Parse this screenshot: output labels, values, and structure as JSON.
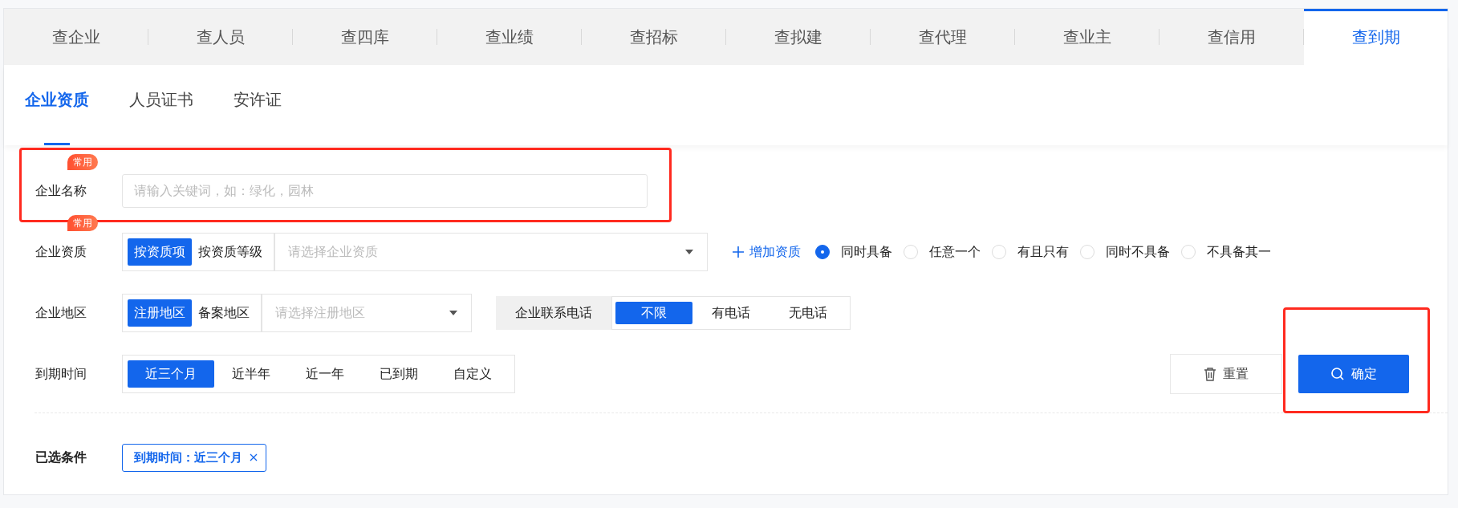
{
  "top_tabs": [
    {
      "label": "查企业",
      "selected": false
    },
    {
      "label": "查人员",
      "selected": false
    },
    {
      "label": "查四库",
      "selected": false
    },
    {
      "label": "查业绩",
      "selected": false
    },
    {
      "label": "查招标",
      "selected": false
    },
    {
      "label": "查拟建",
      "selected": false
    },
    {
      "label": "查代理",
      "selected": false
    },
    {
      "label": "查业主",
      "selected": false
    },
    {
      "label": "查信用",
      "selected": false
    },
    {
      "label": "查到期",
      "selected": true
    }
  ],
  "sub_tabs": [
    {
      "label": "企业资质",
      "selected": true
    },
    {
      "label": "人员证书",
      "selected": false
    },
    {
      "label": "安许证",
      "selected": false
    }
  ],
  "filters": [
    {
      "kind": "input",
      "label": "企业名称",
      "badge": "常用",
      "placeholder": "请输入关键词，如：绿化，园林",
      "highlighted": true
    },
    {
      "kind": "qualification",
      "label": "企业资质",
      "badge": "常用",
      "modes": [
        {
          "label": "按资质项",
          "selected": true
        },
        {
          "label": "按资质等级",
          "selected": false
        }
      ],
      "select_placeholder": "请选择企业资质",
      "add_link": "增加资质",
      "radios": [
        {
          "label": "同时具备",
          "selected": true
        },
        {
          "label": "任意一个",
          "selected": false
        },
        {
          "label": "有且只有",
          "selected": false
        },
        {
          "label": "同时不具备",
          "selected": false
        },
        {
          "label": "不具备其一",
          "selected": false
        }
      ]
    },
    {
      "kind": "region",
      "label": "企业地区",
      "modes": [
        {
          "label": "注册地区",
          "selected": true
        },
        {
          "label": "备案地区",
          "selected": false
        }
      ],
      "select_placeholder": "请选择注册地区",
      "phone": {
        "label": "企业联系电话",
        "options": [
          {
            "label": "不限",
            "selected": true
          },
          {
            "label": "有电话",
            "selected": false
          },
          {
            "label": "无电话",
            "selected": false
          }
        ]
      }
    },
    {
      "kind": "expiry",
      "label": "到期时间",
      "options": [
        {
          "label": "近三个月",
          "selected": true
        },
        {
          "label": "近半年",
          "selected": false
        },
        {
          "label": "近一年",
          "selected": false
        },
        {
          "label": "已到期",
          "selected": false
        },
        {
          "label": "自定义",
          "selected": false
        }
      ]
    }
  ],
  "actions": {
    "reset": {
      "label": "重置"
    },
    "confirm": {
      "label": "确定",
      "highlighted": true
    }
  },
  "selected_conditions": {
    "label": "已选条件",
    "chips": [
      {
        "text": "到期时间：近三个月"
      }
    ]
  }
}
